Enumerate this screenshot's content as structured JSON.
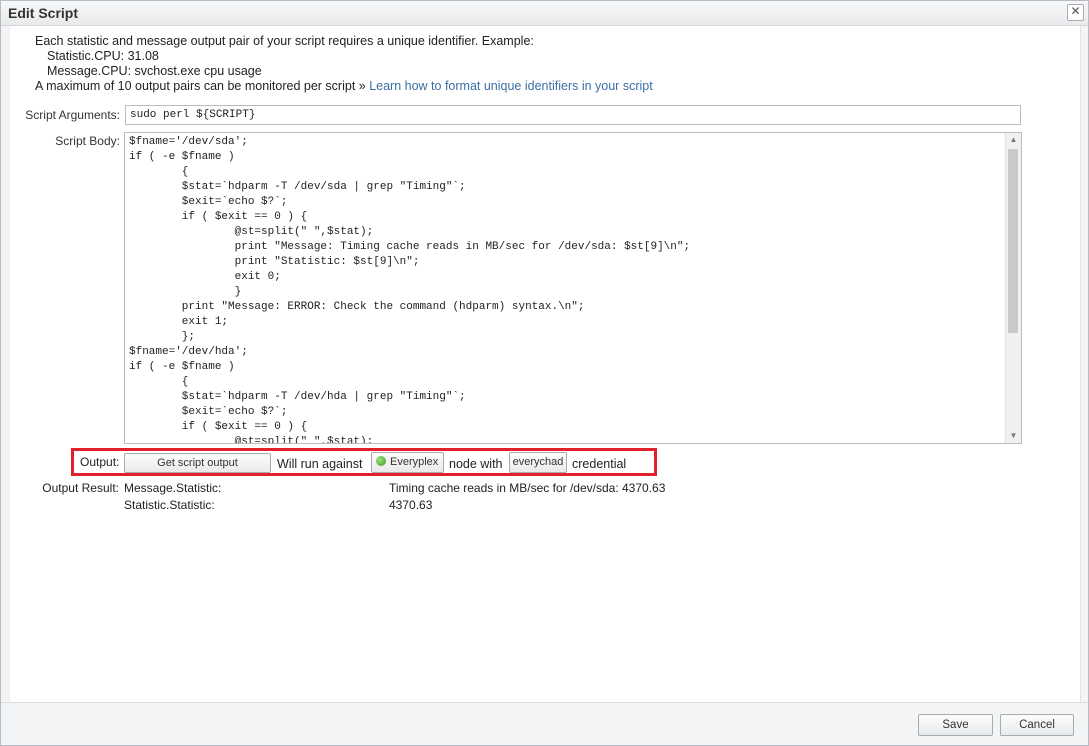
{
  "dialog": {
    "title": "Edit Script",
    "close_icon": "close-icon"
  },
  "intro": {
    "line1": "Each statistic and message output pair of your script requires a unique identifier. Example:",
    "line2": "Statistic.CPU: 31.08",
    "line3": "Message.CPU: svchost.exe cpu usage",
    "line4_text": "A maximum of 10 output pairs can be monitored per script » ",
    "line4_link": "Learn how to format unique identifiers in your script"
  },
  "form": {
    "args_label": "Script Arguments:",
    "args_value": "sudo perl ${SCRIPT}",
    "body_label": "Script Body:",
    "body_lines": [
      "$fname='/dev/sda';",
      "if ( -e $fname )",
      "        {",
      "        $stat=`hdparm -T /dev/sda | grep \"Timing\"`;",
      "        $exit=`echo $?`;",
      "        if ( $exit == 0 ) {",
      "                @st=split(\" \",$stat);",
      "                print \"Message: Timing cache reads in MB/sec for /dev/sda: $st[9]\\n\";",
      "                print \"Statistic: $st[9]\\n\";",
      "                exit 0;",
      "                }",
      "        print \"Message: ERROR: Check the command (hdparm) syntax.\\n\";",
      "        exit 1;",
      "        };",
      "$fname='/dev/hda';",
      "if ( -e $fname )",
      "        {",
      "        $stat=`hdparm -T /dev/hda | grep \"Timing\"`;",
      "        $exit=`echo $?`;",
      "        if ( $exit == 0 ) {",
      "                @st=split(\" \",$stat);"
    ]
  },
  "output": {
    "label": "Output:",
    "get_button": "Get script output",
    "run_text": "Will run against",
    "node_name": "Everyplex",
    "node_status_color": "#3f9b2a",
    "node_text": "node with",
    "credential_name": "everychad",
    "credential_text": "credential"
  },
  "result": {
    "label": "Output Result:",
    "rows": [
      {
        "key": "Message.Statistic:",
        "value": "Timing cache reads in MB/sec for /dev/sda: 4370.63"
      },
      {
        "key": "Statistic.Statistic:",
        "value": "4370.63"
      }
    ]
  },
  "footer": {
    "save": "Save",
    "cancel": "Cancel"
  },
  "colors": {
    "highlight_border": "#e0202a",
    "link": "#3d6fa6"
  }
}
